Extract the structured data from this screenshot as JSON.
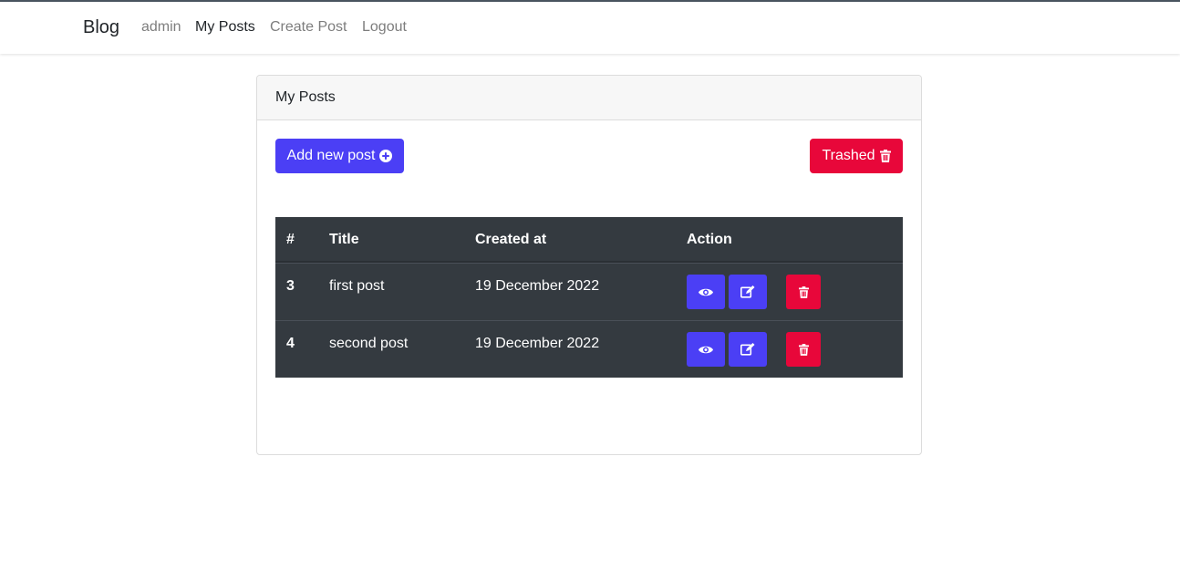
{
  "navbar": {
    "brand": "Blog",
    "links": [
      {
        "label": "admin",
        "active": false
      },
      {
        "label": "My Posts",
        "active": true
      },
      {
        "label": "Create Post",
        "active": false
      },
      {
        "label": "Logout",
        "active": false
      }
    ]
  },
  "card": {
    "header": "My Posts",
    "add_button": {
      "label": "Add new post",
      "icon": "plus-circle-icon"
    },
    "trashed_button": {
      "label": "Trashed",
      "icon": "trash-icon"
    }
  },
  "table": {
    "columns": [
      "#",
      "Title",
      "Created at",
      "Action"
    ],
    "rows": [
      {
        "id": "3",
        "title": "first post",
        "created_at": "19 December 2022"
      },
      {
        "id": "4",
        "title": "second post",
        "created_at": "19 December 2022"
      }
    ],
    "row_actions": [
      "eye-icon",
      "edit-icon",
      "trash-icon"
    ]
  },
  "colors": {
    "primary": "#4b3ff5",
    "danger": "#e8073a",
    "table_dark": "#343a40"
  }
}
